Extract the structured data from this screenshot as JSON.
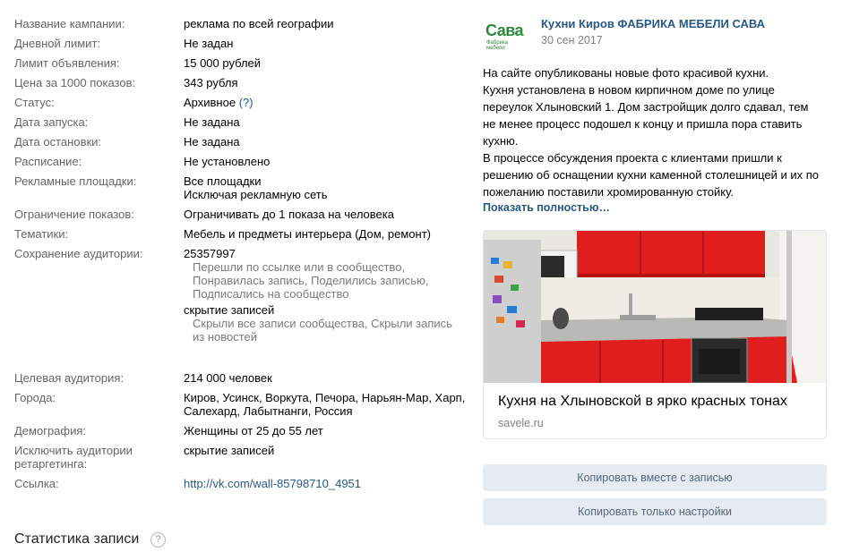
{
  "info": {
    "campaign_name_label": "Название кампании:",
    "campaign_name_value": "реклама по всей географии",
    "daily_limit_label": "Дневной лимит:",
    "daily_limit_value": "Не задан",
    "ad_limit_label": "Лимит объявления:",
    "ad_limit_value": "15 000 рублей",
    "cpm_label": "Цена за 1000 показов:",
    "cpm_value": "343 рубля",
    "status_label": "Статус:",
    "status_value": "Архивное",
    "status_help": "(?)",
    "start_label": "Дата запуска:",
    "start_value": "Не задана",
    "stop_label": "Дата остановки:",
    "stop_value": "Не задана",
    "schedule_label": "Расписание:",
    "schedule_value": "Не установлено",
    "platforms_label": "Рекламные площадки:",
    "platforms_value_1": "Все площадки",
    "platforms_value_2": "Исключая рекламную сеть",
    "impressions_label": "Ограничение показов:",
    "impressions_value": "Ограничивать до 1 показа на человека",
    "topics_label": "Тематики:",
    "topics_value": "Мебель и предметы интерьера (Дом, ремонт)",
    "audience_save_label": "Сохранение аудитории:",
    "audience_save_id": "25357997",
    "audience_save_events": [
      "Перешли по ссылке или в сообщество,",
      "Понравилась запись, Поделились записью,",
      "Подписались на сообщество"
    ],
    "hidden_label": "скрытие записей",
    "hidden_events": [
      "Скрыли все записи сообщества, Скрыли запись",
      "из новостей"
    ],
    "target_label": "Целевая аудитория:",
    "target_value": "214 000 человек",
    "cities_label": "Города:",
    "cities_value_1": "Киров, Усинск, Воркута, Печора, Нарьян-Мар, Харп,",
    "cities_value_2": "Салехард, Лабытнанги, Россия",
    "demography_label": "Демография:",
    "demography_value": "Женщины от 25 до 55 лет",
    "exclude_label_1": "Исключить аудитории",
    "exclude_label_2": "ретаргетинга:",
    "exclude_value": "скрытие записей",
    "link_label": "Ссылка:",
    "link_value": "http://vk.com/wall-85798710_4951"
  },
  "stats": {
    "title": "Статистика записи",
    "help": "?"
  },
  "post": {
    "logo_text": "Сава",
    "logo_sub": "Фабрика мебели",
    "author": "Кухни Киров ФАБРИКА МЕБЕЛИ САВА",
    "date": "30 сен 2017",
    "text_lines": [
      "На сайте опубликованы новые фото красивой кухни.",
      "Кухня установлена в новом кирпичном доме по улице",
      "переулок Хлыновский 1. Дом застройщик долго сдавал, тем",
      "не менее процесс подошел к концу и пришла пора ставить",
      "кухню.",
      "В процессе обсуждения проекта с клиентами пришли к",
      "решению об оснащении кухни каменной столешницей и их по",
      "пожеланию поставили хромированную стойку."
    ],
    "show_more": "Показать полностью…",
    "card_title": "Кухня на Хлыновской в ярко красных тонах",
    "card_domain": "savele.ru"
  },
  "buttons": {
    "copy_with_post": "Копировать вместе с записью",
    "copy_settings": "Копировать только настройки"
  }
}
